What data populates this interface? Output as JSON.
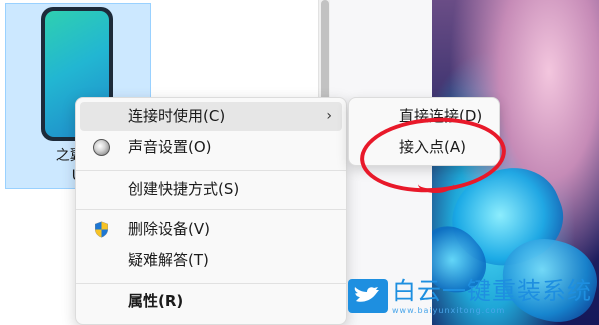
{
  "device": {
    "name_line1": "之翼 自",
    "name_line2": "UI"
  },
  "context_menu": {
    "items": [
      {
        "label": "连接时使用(C)",
        "submenu_indicator": "›"
      },
      {
        "label": "声音设置(O)",
        "icon": "speaker-icon"
      },
      {
        "label": "创建快捷方式(S)"
      },
      {
        "label": "删除设备(V)",
        "icon": "uac-shield-icon"
      },
      {
        "label": "疑难解答(T)"
      },
      {
        "label": "属性(R)"
      }
    ]
  },
  "submenu": {
    "items": [
      {
        "label": "直接连接(D)"
      },
      {
        "label": "接入点(A)"
      }
    ]
  },
  "watermark": {
    "text": "白云一键重装系统",
    "url": "www.baiyunxitong.com"
  },
  "colors": {
    "highlight": "#e8192a",
    "selection": "#cce8ff",
    "watermark": "#1e8fe0"
  }
}
